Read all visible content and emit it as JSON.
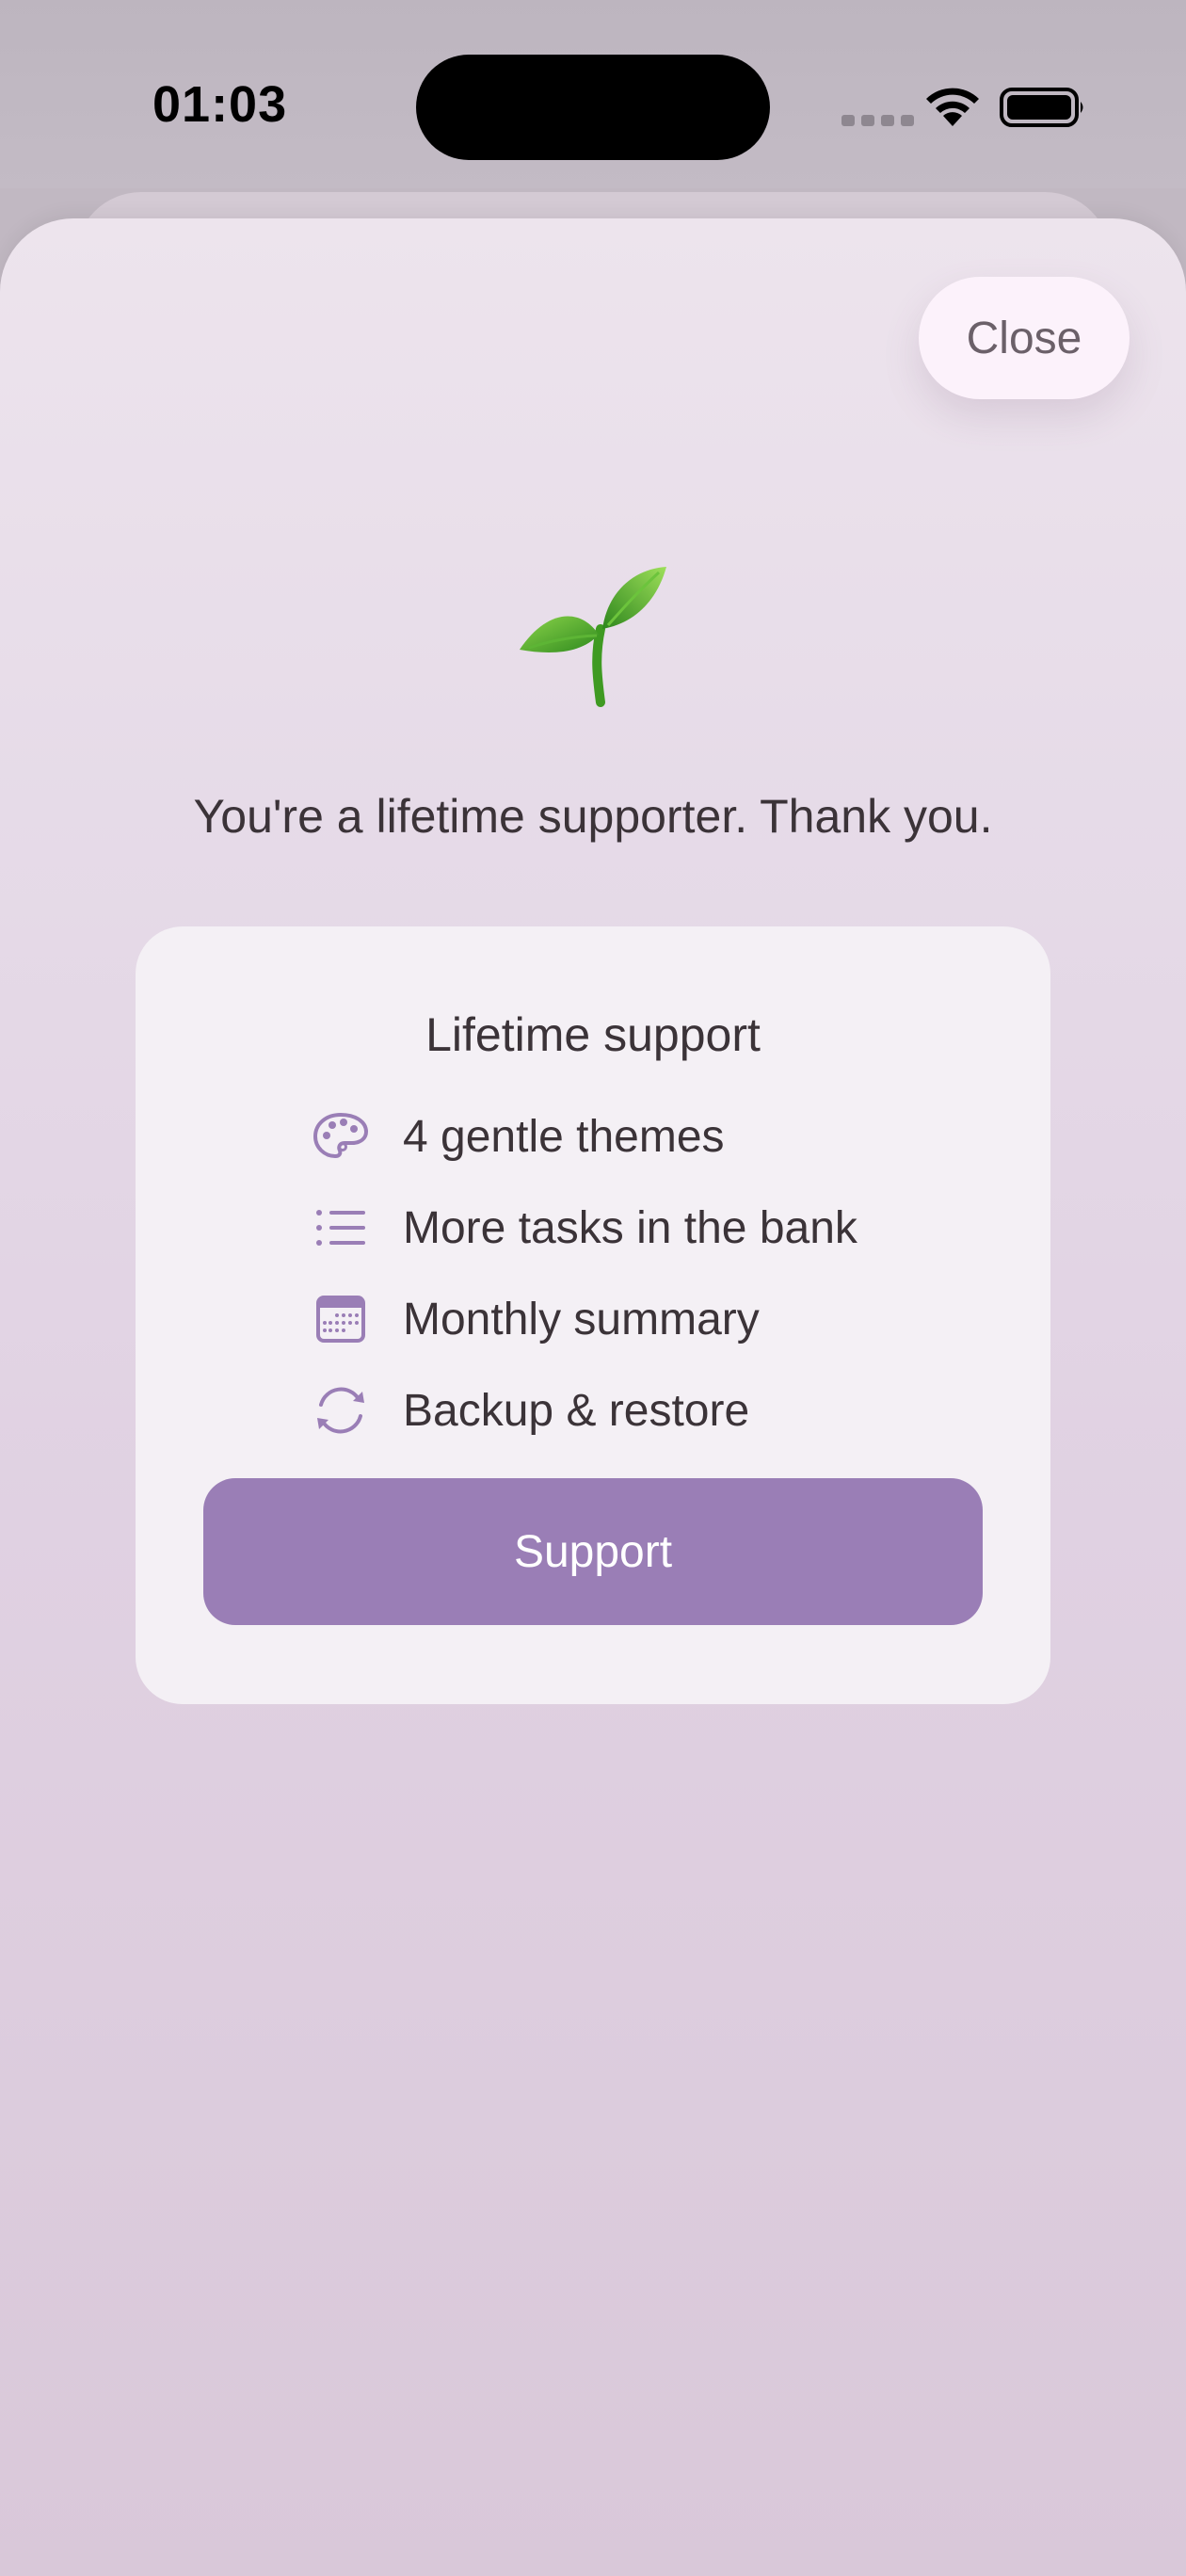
{
  "status_bar": {
    "time": "01:03"
  },
  "sheet": {
    "close_label": "Close",
    "headline": "You're a lifetime supporter. Thank you.",
    "card": {
      "title": "Lifetime support",
      "features": [
        {
          "icon": "palette-icon",
          "label": "4 gentle themes"
        },
        {
          "icon": "list-icon",
          "label": "More tasks in the bank"
        },
        {
          "icon": "calendar-icon",
          "label": "Monthly summary"
        },
        {
          "icon": "sync-icon",
          "label": "Backup & restore"
        }
      ],
      "button_label": "Support"
    }
  },
  "colors": {
    "accent": "#9a7eb6",
    "icon": "#9a7eb6",
    "text": "#3b3338",
    "card": "#f4f0f5",
    "close_button": "#fcf2fb"
  }
}
